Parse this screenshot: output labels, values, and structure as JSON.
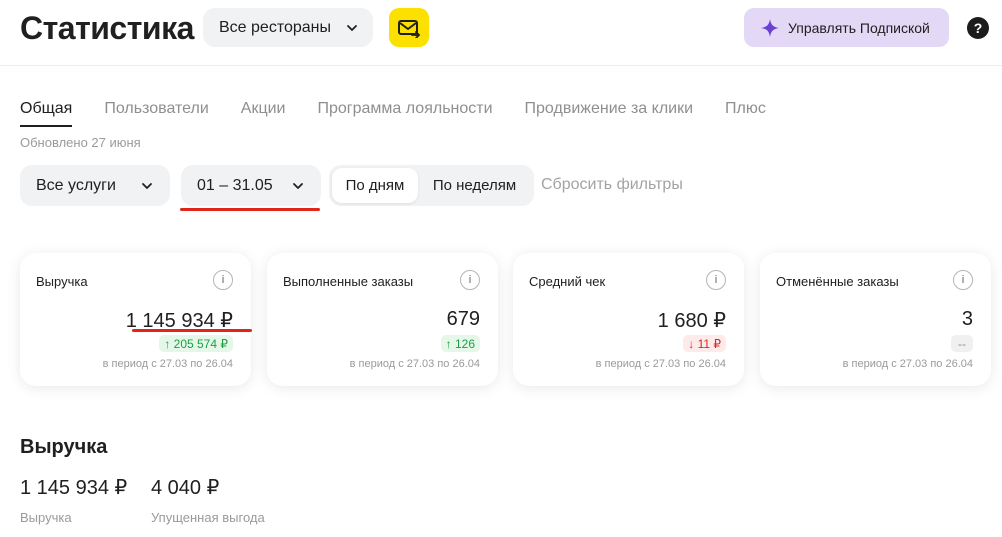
{
  "header": {
    "title": "Статистика",
    "restaurant_select": "Все рестораны",
    "subscription_button": "Управлять Подпиской",
    "help": "?"
  },
  "tabs": [
    {
      "label": "Общая",
      "active": true
    },
    {
      "label": "Пользователи"
    },
    {
      "label": "Акции"
    },
    {
      "label": "Программа лояльности"
    },
    {
      "label": "Продвижение за клики"
    },
    {
      "label": "Плюс"
    }
  ],
  "updated": "Обновлено 27 июня",
  "filters": {
    "services": "Все услуги",
    "date_range": "01 – 31.05",
    "by_days": "По дням",
    "by_weeks": "По неделям",
    "reset": "Сбросить фильтры"
  },
  "cards": [
    {
      "title": "Выручка",
      "value": "1 145 934 ₽",
      "delta": "↑ 205 574 ₽",
      "delta_type": "up",
      "period": "в период с 27.03 по 26.04"
    },
    {
      "title": "Выполненные заказы",
      "value": "679",
      "delta": "↑ 126",
      "delta_type": "up",
      "period": "в период с 27.03 по 26.04"
    },
    {
      "title": "Средний чек",
      "value": "1 680 ₽",
      "delta": "↓ 11 ₽",
      "delta_type": "down",
      "period": "в период с 27.03 по 26.04"
    },
    {
      "title": "Отменённые заказы",
      "value": "3",
      "delta": "--",
      "delta_type": "none",
      "period": "в период с 27.03 по 26.04"
    }
  ],
  "revenue": {
    "title": "Выручка",
    "items": [
      {
        "value": "1 145 934 ₽",
        "caption": "Выручка"
      },
      {
        "value": "4 040 ₽",
        "caption": "Упущенная выгода"
      }
    ]
  },
  "colors": {
    "accent_yellow": "#fce000",
    "subscription_bg": "#e3d8f5",
    "annotation_red": "#e0261b",
    "positive": "#1f9e43",
    "negative": "#e0261b"
  }
}
